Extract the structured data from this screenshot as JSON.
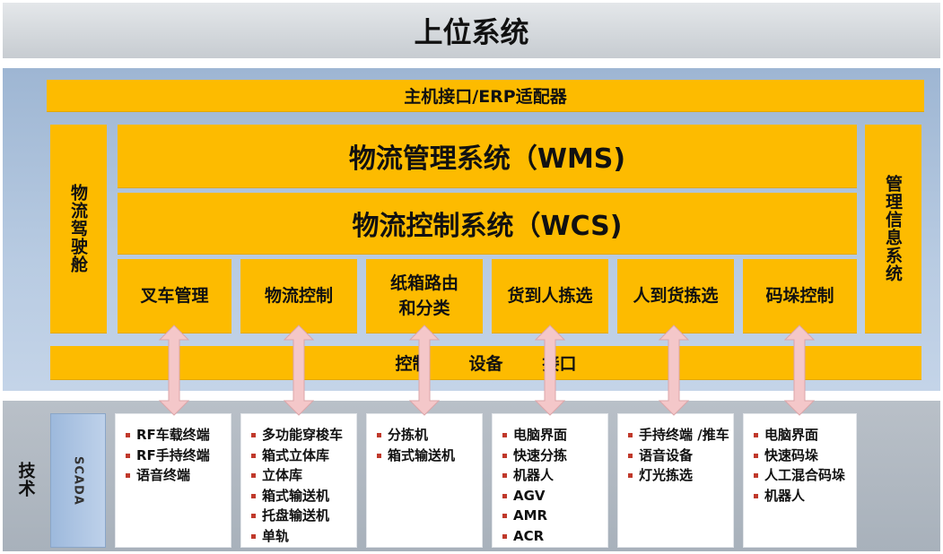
{
  "top_system": "上位系统",
  "host_interface": "主机接口/ERP适配器",
  "left_side": "物流驾驶舱",
  "right_side": "管理信息系统",
  "wms": "物流管理系统（WMS)",
  "wcs": "物流控制系统（WCS)",
  "subsystems": [
    {
      "lines": [
        "叉车管理"
      ]
    },
    {
      "lines": [
        "物流控制"
      ]
    },
    {
      "lines": [
        "纸箱路由",
        "和分类"
      ]
    },
    {
      "lines": [
        "货到人拣选"
      ]
    },
    {
      "lines": [
        "人到货拣选"
      ]
    },
    {
      "lines": [
        "码垛控制"
      ]
    }
  ],
  "control_bar": [
    "控制",
    "设备",
    "接口"
  ],
  "tech_label": "技术",
  "scada_label": "SCADA",
  "arrow_color": "#f4c7c9",
  "accent_yellow": "#fdbb00",
  "devices": [
    {
      "items": [
        "RF车载终端",
        "RF手持终端",
        "语音终端"
      ]
    },
    {
      "items": [
        "多功能穿梭车",
        "箱式立体库",
        "立体库",
        "箱式输送机",
        "托盘输送机",
        "单轨"
      ]
    },
    {
      "items": [
        "分拣机",
        "箱式输送机"
      ]
    },
    {
      "items": [
        "电脑界面",
        "快速分拣",
        "机器人",
        "AGV",
        "AMR",
        "ACR"
      ]
    },
    {
      "items": [
        "手持终端 /推车",
        "语音设备",
        "灯光拣选"
      ]
    },
    {
      "items": [
        "电脑界面",
        "快速码垛",
        "人工混合码垛",
        "机器人"
      ]
    }
  ]
}
